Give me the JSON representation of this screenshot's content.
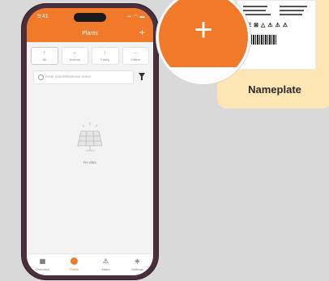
{
  "phone": {
    "status": {
      "time": "9:41",
      "icons": "▪▪ ◠ ▬"
    },
    "header": {
      "title": "Plants",
      "add_symbol": "+"
    },
    "tabs": [
      {
        "icon": "!",
        "label": "All",
        "color": "#3a6ad0"
      },
      {
        "icon": "✓",
        "label": "Normal",
        "color": "#2a9a4a"
      },
      {
        "icon": "!",
        "label": "Faulty",
        "color": "#d03a3a"
      },
      {
        "icon": "—",
        "label": "Offline",
        "color": "#999999"
      }
    ],
    "search": {
      "placeholder": "Enter plant/SN/device name"
    },
    "empty": {
      "label": "No data"
    },
    "nav": [
      {
        "icon": "▦",
        "label": "Overview"
      },
      {
        "icon": "",
        "label": "Plants"
      },
      {
        "icon": "⚠",
        "label": "Alarm"
      },
      {
        "icon": "⎈",
        "label": "Settings"
      }
    ]
  },
  "callout": {
    "plus_symbol": "+",
    "nameplate_label": "Nameplate",
    "sheet_marks": "CE ⊠ △ ⚠ ⚠ ⚠"
  },
  "colors": {
    "accent": "#f07a2a",
    "nameplate_bg": "#fde5b4"
  }
}
